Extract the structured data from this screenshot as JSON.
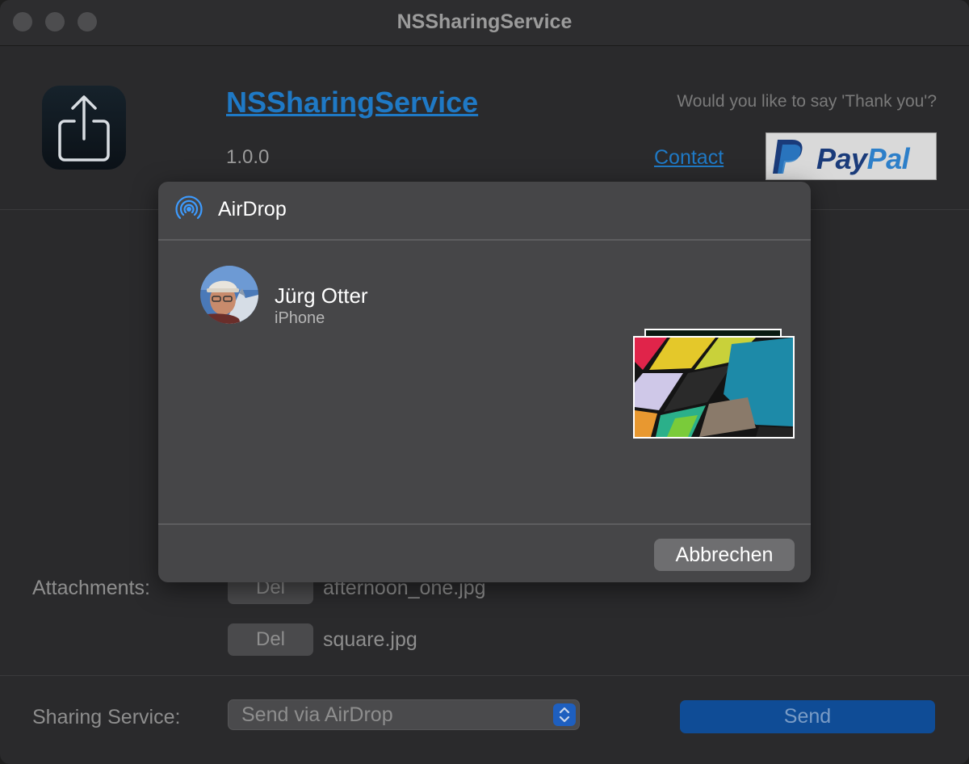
{
  "window": {
    "title": "NSSharingService"
  },
  "header": {
    "app_name": "NSSharingService",
    "version": "1.0.0",
    "thanks_text": "Would you like to say 'Thank you'?",
    "contact_link": "Contact",
    "paypal": {
      "pay": "Pay",
      "pal": "Pal"
    }
  },
  "attachments": {
    "label": "Attachments:",
    "items": [
      {
        "delete_label": "Del",
        "filename": "afternoon_one.jpg"
      },
      {
        "delete_label": "Del",
        "filename": "square.jpg"
      }
    ]
  },
  "sharing": {
    "label": "Sharing Service:",
    "selected": "Send via AirDrop",
    "send_label": "Send"
  },
  "airdrop_dialog": {
    "title": "AirDrop",
    "contact": {
      "name": "Jürg Otter",
      "device": "iPhone"
    },
    "cancel_label": "Abbrechen"
  },
  "colors": {
    "accent": "#1f79c5",
    "send_button": "#0f4c96",
    "dialog_bg": "#464648",
    "window_bg": "#2a2a2c"
  },
  "icons": {
    "app": "share-icon",
    "airdrop": "airdrop-icon",
    "stepper": "chevron-up-down-icon"
  }
}
